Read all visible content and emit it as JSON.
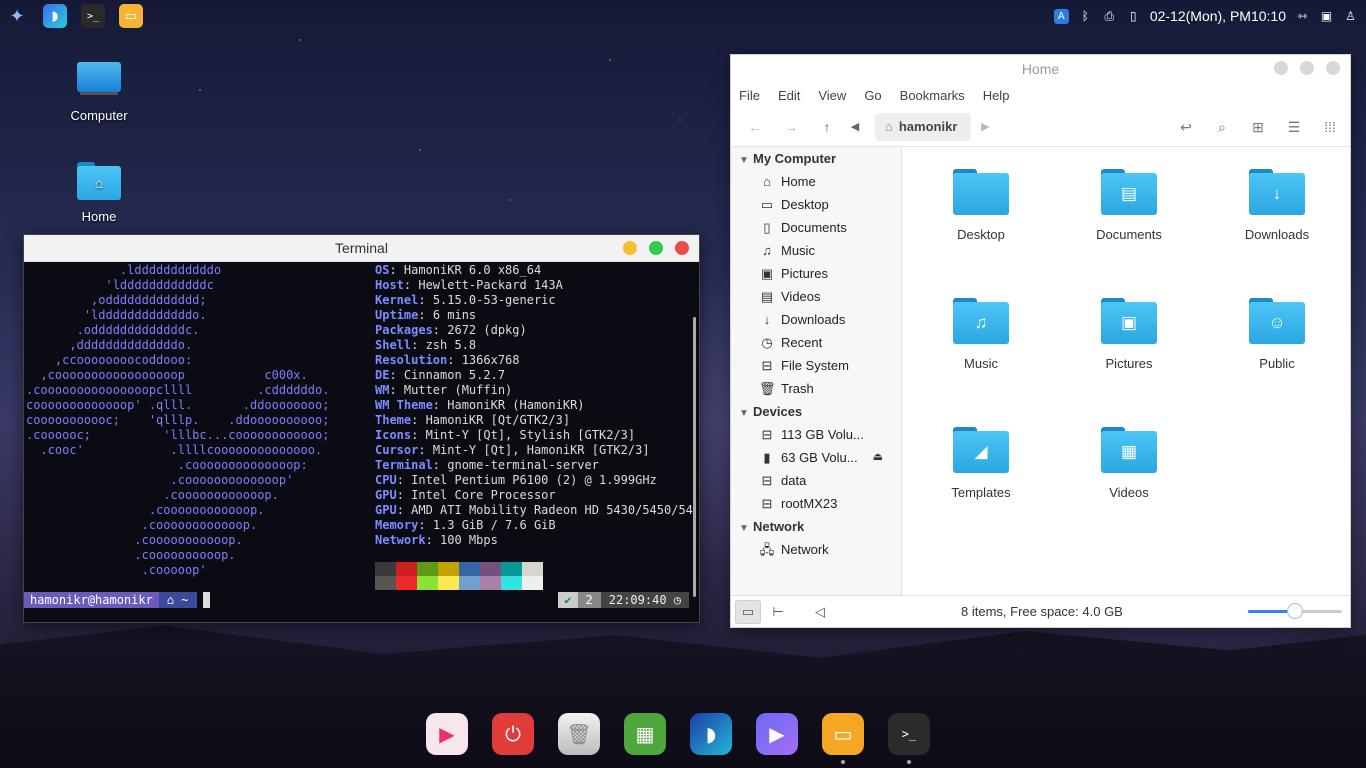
{
  "panel": {
    "clock": "02-12(Mon), PM10:10",
    "launchers": [
      "app-menu",
      "browser",
      "terminal",
      "files"
    ]
  },
  "desktop": {
    "icons": [
      {
        "label": "Computer"
      },
      {
        "label": "Home"
      }
    ]
  },
  "terminal": {
    "title": "Terminal",
    "ascii": [
      "             .ldddddddddddo",
      "           'lddddddddddddc",
      "         ,oddddddddddddd;",
      "        'ldddddddddddddo.",
      "       .odddddddddddddc.",
      "      ,ddddddddddddddo.",
      "    ,ccoooooooocoddooo:",
      "  ,cooooooooooooooooop           c000x.",
      ".cooooooooooooooopcllll         .cddddddo.",
      "cooooooooooooop' .qlll.       .ddoooooooo;",
      "cooooooooooc;    'qlllp.    .ddoooooooooo;",
      ".coooooc;          'lllbc...coooooooooooo;",
      "  .cooc'            .llllcoooooooooooooo.",
      "                     .coooooooooooooop:",
      "                    .cooooooooooooop'",
      "                   .coooooooooooop.",
      "                 .coooooooooooop.",
      "                .coooooooooooop.",
      "               .cooooooooooop.",
      "               .coooooooooop.",
      "                .cooooop'"
    ],
    "info": [
      {
        "k": "OS",
        "v": "HamoniKR 6.0 x86_64"
      },
      {
        "k": "Host",
        "v": "Hewlett-Packard 143A"
      },
      {
        "k": "Kernel",
        "v": "5.15.0-53-generic"
      },
      {
        "k": "Uptime",
        "v": "6 mins"
      },
      {
        "k": "Packages",
        "v": "2672 (dpkg)"
      },
      {
        "k": "Shell",
        "v": "zsh 5.8"
      },
      {
        "k": "Resolution",
        "v": "1366x768"
      },
      {
        "k": "DE",
        "v": "Cinnamon 5.2.7"
      },
      {
        "k": "WM",
        "v": "Mutter (Muffin)"
      },
      {
        "k": "WM Theme",
        "v": "HamoniKR (HamoniKR)"
      },
      {
        "k": "Theme",
        "v": "HamoniKR [Qt/GTK2/3]"
      },
      {
        "k": "Icons",
        "v": "Mint-Y [Qt], Stylish [GTK2/3]"
      },
      {
        "k": "Cursor",
        "v": "Mint-Y [Qt], HamoniKR [GTK2/3]"
      },
      {
        "k": "Terminal",
        "v": "gnome-terminal-server"
      },
      {
        "k": "CPU",
        "v": "Intel Pentium P6100 (2) @ 1.999GHz"
      },
      {
        "k": "GPU",
        "v": "Intel Core Processor"
      },
      {
        "k": "GPU",
        "v": "AMD ATI Mobility Radeon HD 5430/5450/54"
      },
      {
        "k": "Memory",
        "v": "1.3 GiB / 7.6 GiB"
      },
      {
        "k": "Network",
        "v": "100 Mbps"
      }
    ],
    "palette_top": [
      "#3a3a3a",
      "#cc1f1f",
      "#5e9a16",
      "#c4a000",
      "#3465a4",
      "#75507b",
      "#06989a",
      "#d3d7cf"
    ],
    "palette_bottom": [
      "#555753",
      "#ef2929",
      "#8ae234",
      "#fce94f",
      "#729fcf",
      "#ad7fa8",
      "#34e2e2",
      "#eeeeec"
    ],
    "prompt_user": "hamonikr@hamonikr",
    "prompt_dir": "⌂ ~",
    "prompt_ok": "✔",
    "prompt_jobs": "2",
    "prompt_time": "22:09:40 ◷"
  },
  "filemanager": {
    "title": "Home",
    "menu": [
      "File",
      "Edit",
      "View",
      "Go",
      "Bookmarks",
      "Help"
    ],
    "breadcrumb": "hamonikr",
    "sections": [
      {
        "title": "My Computer",
        "items": [
          {
            "label": "Home",
            "icon": "⌂"
          },
          {
            "label": "Desktop",
            "icon": "▭"
          },
          {
            "label": "Documents",
            "icon": "▯"
          },
          {
            "label": "Music",
            "icon": "♫"
          },
          {
            "label": "Pictures",
            "icon": "▣"
          },
          {
            "label": "Videos",
            "icon": "▤"
          },
          {
            "label": "Downloads",
            "icon": "↓"
          },
          {
            "label": "Recent",
            "icon": "◷"
          },
          {
            "label": "File System",
            "icon": "⊟"
          },
          {
            "label": "Trash",
            "icon": "🗑"
          }
        ]
      },
      {
        "title": "Devices",
        "items": [
          {
            "label": "113 GB Volu...",
            "icon": "⊟"
          },
          {
            "label": "63 GB Volu...",
            "icon": "▮"
          },
          {
            "label": "data",
            "icon": "⊟"
          },
          {
            "label": "rootMX23",
            "icon": "⊟"
          }
        ]
      },
      {
        "title": "Network",
        "items": [
          {
            "label": "Network",
            "icon": "🖧"
          }
        ]
      }
    ],
    "files": [
      {
        "label": "Desktop",
        "glyph": ""
      },
      {
        "label": "Documents",
        "glyph": "▤"
      },
      {
        "label": "Downloads",
        "glyph": "↓"
      },
      {
        "label": "Music",
        "glyph": "♫"
      },
      {
        "label": "Pictures",
        "glyph": "▣"
      },
      {
        "label": "Public",
        "glyph": "☺"
      },
      {
        "label": "Templates",
        "glyph": "◢"
      },
      {
        "label": "Videos",
        "glyph": "▦"
      }
    ],
    "status": "8 items, Free space: 4.0 GB",
    "zoom_fraction": 0.5
  },
  "dock": [
    "media-player",
    "power",
    "trash",
    "software-store",
    "browser",
    "video-player",
    "files",
    "terminal"
  ]
}
